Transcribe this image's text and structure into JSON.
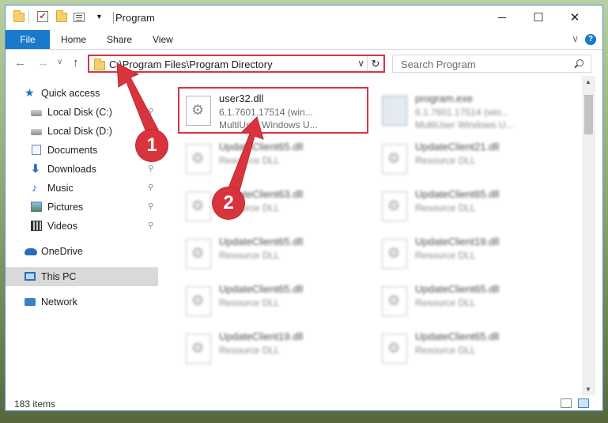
{
  "window": {
    "title": "Program",
    "controls": {
      "minimize": "─",
      "maximize": "☐",
      "close": "✕"
    }
  },
  "ribbon": {
    "tabs": [
      "File",
      "Home",
      "Share",
      "View"
    ],
    "help": "?",
    "expand": "∨"
  },
  "nav": {
    "back": "←",
    "forward": "→",
    "dropdown": "∨",
    "up": "↑",
    "address": "C:\\Program Files\\Program Directory",
    "refresh": "↻",
    "search_placeholder": "Search Program"
  },
  "sidebar": {
    "items": [
      {
        "label": "Quick access",
        "icon": "star-icon"
      },
      {
        "label": "Local Disk (C:)",
        "icon": "disk-icon",
        "pinned": true
      },
      {
        "label": "Local Disk (D:)",
        "icon": "disk-icon",
        "pinned": true
      },
      {
        "label": "Documents",
        "icon": "documents-icon",
        "pinned": true
      },
      {
        "label": "Downloads",
        "icon": "downloads-icon",
        "pinned": true
      },
      {
        "label": "Music",
        "icon": "music-icon",
        "pinned": true
      },
      {
        "label": "Pictures",
        "icon": "pictures-icon",
        "pinned": true
      },
      {
        "label": "Videos",
        "icon": "videos-icon",
        "pinned": true
      },
      {
        "label": "OneDrive",
        "icon": "cloud-icon"
      },
      {
        "label": "This PC",
        "icon": "pc-icon",
        "selected": true
      },
      {
        "label": "Network",
        "icon": "network-icon"
      }
    ],
    "pin_glyph": "📌"
  },
  "files": {
    "highlighted": {
      "name": "user32.dll",
      "line2": "6.1.7601.17514 (win...",
      "line3": "MultiUser Windows U..."
    },
    "exe": {
      "name": "program.exe",
      "line2": "6.1.7601.17514 (win...",
      "line3": "MultiUser Windows U..."
    },
    "left_col": [
      {
        "name": "UpdateClient65.dll",
        "desc": "Resource DLL"
      },
      {
        "name": "UpdateClient63.dll",
        "desc": "Resource DLL"
      },
      {
        "name": "UpdateClient65.dll",
        "desc": "Resource DLL"
      },
      {
        "name": "UpdateClient65.dll",
        "desc": "Resource DLL"
      },
      {
        "name": "UpdateClient19.dll",
        "desc": "Resource DLL"
      }
    ],
    "right_col": [
      {
        "name": "UpdateClient21.dll",
        "desc": "Resource DLL"
      },
      {
        "name": "UpdateClient65.dll",
        "desc": "Resource DLL"
      },
      {
        "name": "UpdateClient19.dll",
        "desc": "Resource DLL"
      },
      {
        "name": "UpdateClient65.dll",
        "desc": "Resource DLL"
      },
      {
        "name": "UpdateClient65.dll",
        "desc": "Resource DLL"
      }
    ]
  },
  "status": {
    "items": "183 items"
  },
  "annotations": {
    "step1": "1",
    "step2": "2"
  },
  "colors": {
    "accent": "#1979ca",
    "highlight": "#d9343d",
    "selected": "#d9d9d9"
  }
}
